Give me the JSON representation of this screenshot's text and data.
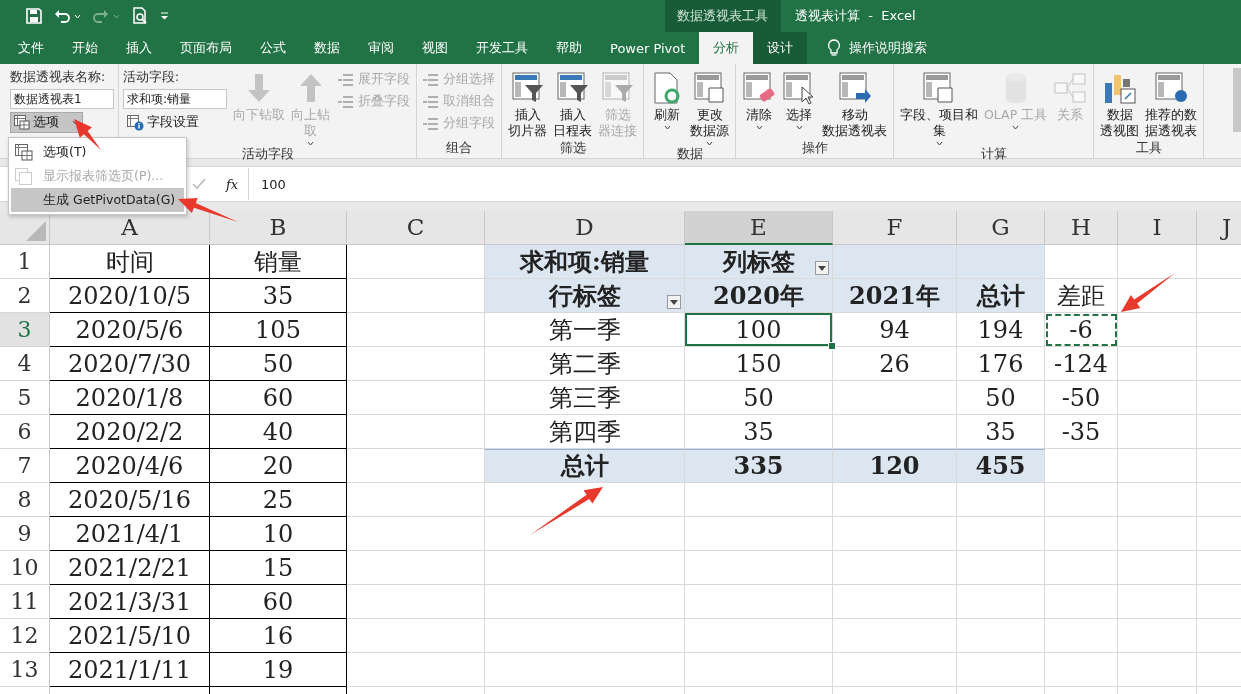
{
  "title_bar": {
    "context_label": "数据透视表工具",
    "title": "透视表计算  -  Excel"
  },
  "tabs": [
    {
      "label": "文件",
      "selected": false,
      "kind": "normal"
    },
    {
      "label": "开始",
      "selected": false,
      "kind": "normal"
    },
    {
      "label": "插入",
      "selected": false,
      "kind": "normal"
    },
    {
      "label": "页面布局",
      "selected": false,
      "kind": "normal"
    },
    {
      "label": "公式",
      "selected": false,
      "kind": "normal"
    },
    {
      "label": "数据",
      "selected": false,
      "kind": "normal"
    },
    {
      "label": "审阅",
      "selected": false,
      "kind": "normal"
    },
    {
      "label": "视图",
      "selected": false,
      "kind": "normal"
    },
    {
      "label": "开发工具",
      "selected": false,
      "kind": "normal"
    },
    {
      "label": "帮助",
      "selected": false,
      "kind": "normal"
    },
    {
      "label": "Power Pivot",
      "selected": false,
      "kind": "normal"
    },
    {
      "label": "分析",
      "selected": true,
      "kind": "context"
    },
    {
      "label": "设计",
      "selected": false,
      "kind": "context"
    }
  ],
  "tell_me": "操作说明搜索",
  "ribbon": {
    "groups": [
      {
        "sections": [
          {
            "kind": "field",
            "caption": "数据透视表名称:",
            "value": "数据透视表1",
            "button": {
              "label": "选项",
              "pressed": true,
              "has_menu": true
            }
          }
        ]
      },
      {
        "label": "活动字段",
        "sections": [
          {
            "kind": "field",
            "caption": "活动字段:",
            "value": "求和项:销量",
            "button": {
              "label": "字段设置",
              "pressed": false,
              "has_menu": false
            }
          },
          {
            "kind": "large",
            "buttons": [
              {
                "lines": [
                  "向下钻取"
                ],
                "disabled": true,
                "has_menu": false
              },
              {
                "lines": [
                  "向上钻",
                  "取"
                ],
                "disabled": true,
                "has_menu": true
              }
            ]
          },
          {
            "kind": "small",
            "buttons": [
              {
                "label": "展开字段",
                "disabled": true
              },
              {
                "label": "折叠字段",
                "disabled": true
              }
            ]
          }
        ]
      },
      {
        "label": "组合",
        "sections": [
          {
            "kind": "small",
            "buttons": [
              {
                "label": "分组选择",
                "disabled": true
              },
              {
                "label": "取消组合",
                "disabled": true
              },
              {
                "label": "分组字段",
                "disabled": true
              }
            ]
          }
        ]
      },
      {
        "label": "筛选",
        "sections": [
          {
            "kind": "large",
            "buttons": [
              {
                "lines": [
                  "插入",
                  "切片器"
                ],
                "disabled": false,
                "has_menu": false
              },
              {
                "lines": [
                  "插入",
                  "日程表"
                ],
                "disabled": false,
                "has_menu": false
              },
              {
                "lines": [
                  "筛选",
                  "器连接"
                ],
                "disabled": true,
                "has_menu": false
              }
            ]
          }
        ]
      },
      {
        "label": "数据",
        "sections": [
          {
            "kind": "large",
            "buttons": [
              {
                "lines": [
                  "刷新"
                ],
                "disabled": false,
                "has_menu": true
              },
              {
                "lines": [
                  "更改",
                  "数据源"
                ],
                "disabled": false,
                "has_menu": true
              }
            ]
          }
        ]
      },
      {
        "label": "操作",
        "sections": [
          {
            "kind": "large",
            "buttons": [
              {
                "lines": [
                  "清除"
                ],
                "disabled": false,
                "has_menu": true
              },
              {
                "lines": [
                  "选择"
                ],
                "disabled": false,
                "has_menu": true
              },
              {
                "lines": [
                  "移动",
                  "数据透视表"
                ],
                "disabled": false,
                "has_menu": false
              }
            ]
          }
        ]
      },
      {
        "label": "计算",
        "sections": [
          {
            "kind": "large",
            "buttons": [
              {
                "lines": [
                  "字段、项目和",
                  "集"
                ],
                "disabled": false,
                "has_menu": true
              },
              {
                "lines": [
                  "OLAP 工具"
                ],
                "disabled": true,
                "has_menu": true
              },
              {
                "lines": [
                  "关系"
                ],
                "disabled": true,
                "has_menu": false
              }
            ]
          }
        ]
      },
      {
        "label": "工具",
        "sections": [
          {
            "kind": "large",
            "buttons": [
              {
                "lines": [
                  "数据",
                  "透视图"
                ],
                "disabled": false,
                "has_menu": false
              },
              {
                "lines": [
                  "推荐的数",
                  "据透视表"
                ],
                "disabled": false,
                "has_menu": false
              }
            ]
          }
        ]
      }
    ]
  },
  "menu": {
    "items": [
      {
        "label": "选项(T)",
        "disabled": false,
        "selected": false
      },
      {
        "label": "显示报表筛选页(P)...",
        "disabled": true,
        "selected": false
      },
      {
        "label": "生成 GetPivotData(G)",
        "disabled": false,
        "selected": true
      }
    ]
  },
  "formula_bar": {
    "fx_label": "fx",
    "value": "100"
  },
  "sheet": {
    "columns": [
      "A",
      "B",
      "C",
      "D",
      "E",
      "F",
      "G",
      "H",
      "I",
      "J"
    ],
    "rows": [
      {
        "header": "1",
        "kind": "pivot-header",
        "cells": [
          "时间",
          "销量",
          null,
          "求和项:销量",
          {
            "text": "列标签",
            "kind": "filter"
          }
        ]
      },
      {
        "header": "2",
        "kind": "pivot-header",
        "cells": [
          "2020/10/5",
          "35",
          null,
          {
            "text": "行标签",
            "kind": "filter"
          },
          "2020年",
          "2021年",
          "总计",
          "差距"
        ]
      },
      {
        "header": "3",
        "kind": "pivot-body",
        "cells": [
          "2020/5/6",
          "105",
          null,
          "第一季",
          {
            "text": "100",
            "kind": "active"
          },
          "94",
          "194",
          {
            "text": "-6",
            "kind": "copied"
          }
        ]
      },
      {
        "header": "4",
        "kind": "pivot-body",
        "cells": [
          "2020/7/30",
          "50",
          null,
          "第二季",
          "150",
          "26",
          "176",
          "-124"
        ]
      },
      {
        "header": "5",
        "kind": "pivot-body",
        "cells": [
          "2020/1/8",
          "60",
          null,
          "第三季",
          "50",
          null,
          "50",
          "-50"
        ]
      },
      {
        "header": "6",
        "kind": "pivot-body",
        "cells": [
          "2020/2/2",
          "40",
          null,
          "第四季",
          "35",
          null,
          "35",
          "-35"
        ]
      },
      {
        "header": "7",
        "kind": "pivot-total",
        "cells": [
          "2020/4/6",
          "20",
          null,
          "总计",
          "335",
          "120",
          "455"
        ]
      },
      {
        "header": "8",
        "kind": "plain",
        "cells": [
          "2020/5/16",
          "25"
        ]
      },
      {
        "header": "9",
        "kind": "plain",
        "cells": [
          "2021/4/1",
          "10"
        ]
      },
      {
        "header": "10",
        "kind": "plain",
        "cells": [
          "2021/2/21",
          "15"
        ]
      },
      {
        "header": "11",
        "kind": "plain",
        "cells": [
          "2021/3/31",
          "60"
        ]
      },
      {
        "header": "12",
        "kind": "plain",
        "cells": [
          "2021/5/10",
          "16"
        ]
      },
      {
        "header": "13",
        "kind": "plain",
        "cells": [
          "2021/1/11",
          "19"
        ]
      }
    ]
  }
}
